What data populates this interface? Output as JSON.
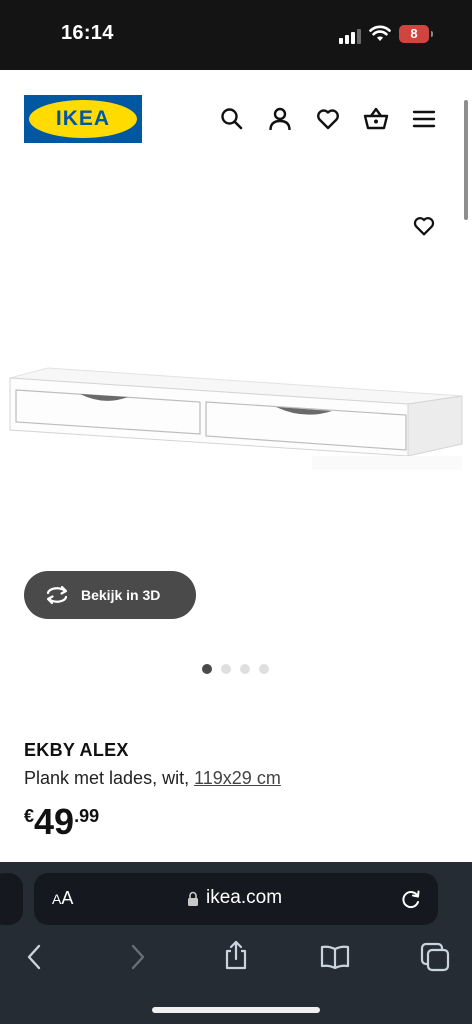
{
  "status_bar": {
    "time": "16:14",
    "battery": "8"
  },
  "header": {
    "logo_text": "IKEA",
    "icons": [
      "search-icon",
      "user-icon",
      "heart-icon",
      "basket-icon",
      "menu-icon"
    ]
  },
  "gallery": {
    "view_3d_label": "Bekijk in 3D",
    "slide_count": 4,
    "active_slide": 1
  },
  "product": {
    "name": "EKBY ALEX",
    "description": "Plank met lades, wit,",
    "dimensions": "119x29 cm",
    "price_currency": "€",
    "price_integer": "49",
    "price_decimal": ".99"
  },
  "browser": {
    "text_size_label": "AA",
    "url": "ikea.com"
  },
  "colors": {
    "ikea_blue": "#0058a3",
    "ikea_yellow": "#ffdb00",
    "status_bar_bg": "#141414",
    "browser_bar_bg": "#262c33",
    "button_3d_bg": "#4a4a4a",
    "battery_red": "#d0453f"
  }
}
